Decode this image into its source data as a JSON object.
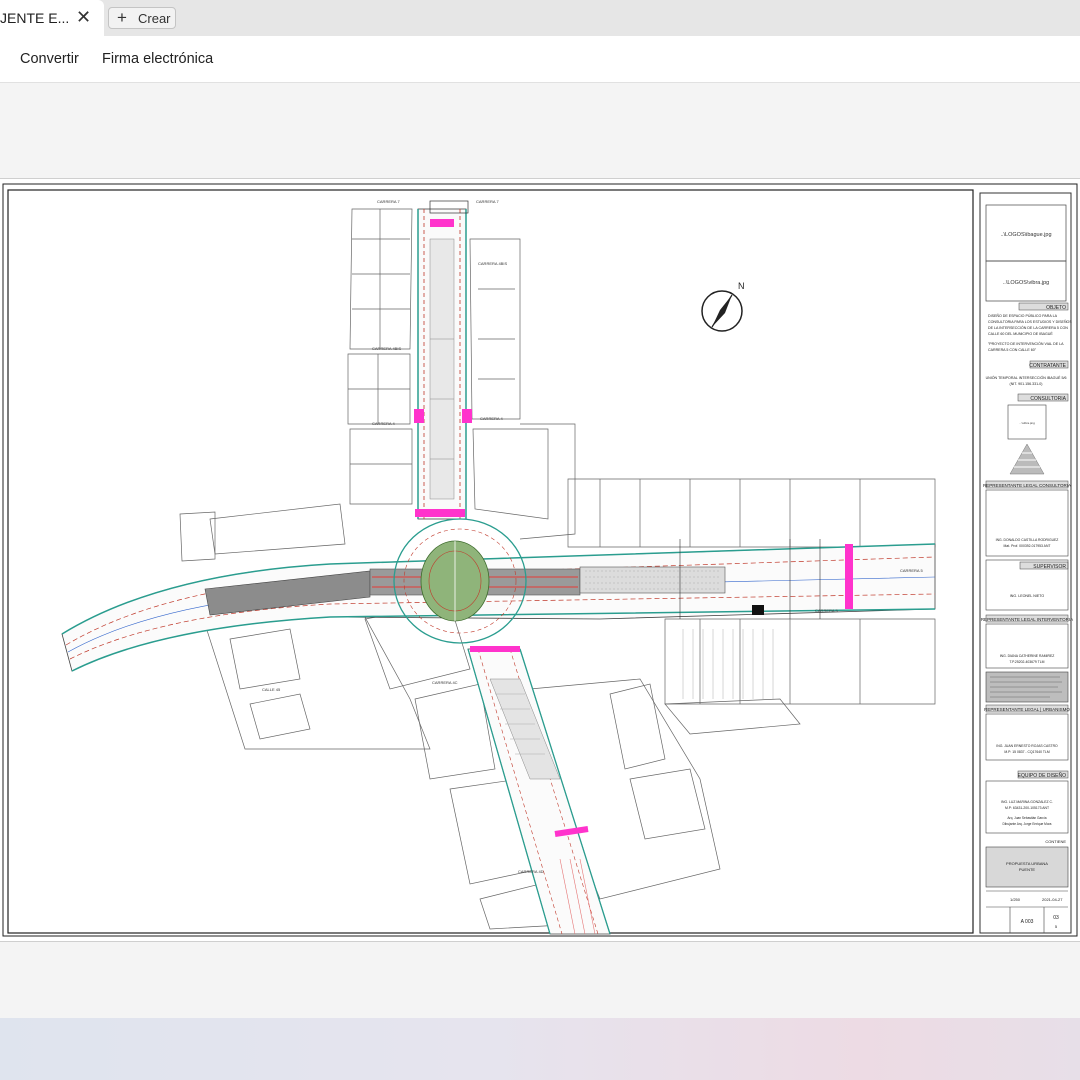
{
  "tab": {
    "title": "JENTE E...",
    "close_glyph": "✕"
  },
  "new_tab": {
    "glyph": "+",
    "label": "Crear"
  },
  "toolbar": {
    "convert_label": "Convertir",
    "sign_label": "Firma electrónica"
  },
  "plan": {
    "streets": {
      "carrera7_top_left": "CARRERA 7",
      "carrera7_top_right": "CARRERA 7",
      "carrera_a_right": "CARRERA 4BIS",
      "carrera_a_left": "CARRERA 4BIS",
      "carrera5_left": "CARRERA 4",
      "carrera4_right": "CARRERA 4",
      "carrera5_east_top": "CARRERA 5",
      "carrera5_east_mid": "CARRERA 5",
      "calle_bottom": "CARRERA 4D",
      "calle_lower": "CARRERA 4C",
      "calle_left": "CALLE 45"
    }
  },
  "title_block": {
    "logo1": "..\\LOGOS\\ibague.jpg",
    "logo2": "..\\LOGOS\\vibra.jpg",
    "objeto_header": "OBJETO",
    "objeto_text": [
      "DISEÑO DE ESPACIO PÚBLICO PARA LA",
      "CONSULTORIA PARA LOS ESTUDIOS Y DISEÑOS",
      "DE LA INTERSECCIÓN DE LA CARRERA 5 CON",
      "CALLE 60 DEL MUNICIPIO DE IBAGUÉ"
    ],
    "proyecto_text": [
      "\"PROYECTO DE INTERVENCIÓN VIAL DE LA",
      "CARRERA 5 CON CALLE 60\""
    ],
    "contratante_header": "CONTRATANTE",
    "contratante_text": [
      "UNIÓN TEMPORAL INTERSECCIÓN IBAGUÉ 5/6",
      "(NIT. 901.156.331-0)"
    ],
    "consultoria_header": "CONSULTORIA",
    "consultoria_logo_text": "...\\vibra.png",
    "rep_consultoria_header": "REPRESENTANTE LEGAL CONSULTORIA",
    "rep_consultoria_text": [
      "ING. DONALDO CASTILLA RODRIGUEZ",
      "Mat. Prof. 000392-017953 ANT"
    ],
    "supervisor_header": "SUPERVISOR",
    "supervisor_text": "ING. LEONEL NIETO",
    "rep_interventoria_header": "REPRESENTANTE LEGAL INTERVENTORIA",
    "rep_interventoria_text": [
      "ING. DIANA CATHERINE RAMIREZ",
      "T.P.25202-403679 TLM"
    ],
    "rep_urbanismo_header": "REPRESENTANTE LEGAL | URBANISMO",
    "rep_urbanismo_text": [
      "ING. JUAN ERNESTO ROJAS CASTRO",
      "M.P: 15 0837 - CQ17640 TLM"
    ],
    "equipo_header": "EQUIPO DE DISEÑO",
    "equipo_text": [
      "ING. LUZ MARINA GONZALEZ C.",
      "M.P: 63431-200-105173 ANT",
      "Arq. Juan Sebastián García",
      "Dibujante Arq. Jorge Enrique Mora"
    ],
    "contiene_header": "CONTIENE",
    "contiene_text": [
      "PROPUESTA URBANA",
      "PUENTE"
    ],
    "escala": "1/250",
    "fecha": "2021-04-27",
    "plano": "A 003",
    "hoja_numbers": [
      "03",
      "5"
    ]
  }
}
